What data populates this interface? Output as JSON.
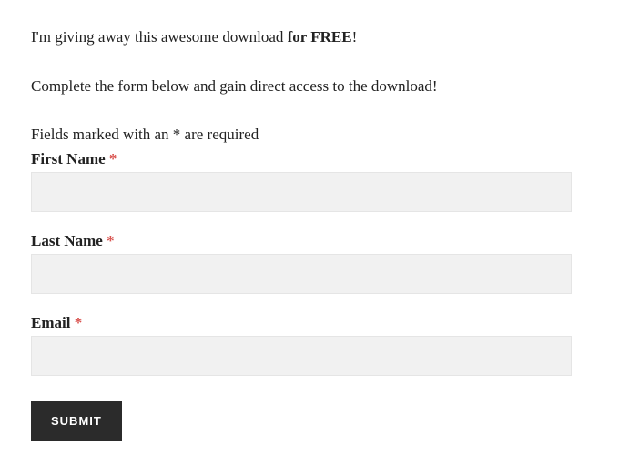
{
  "intro": {
    "prefix": "I'm giving away this awesome download ",
    "bold": "for FREE",
    "suffix": "!"
  },
  "subtext": "Complete the form below and gain direct access to the download!",
  "required_note": "Fields marked with an * are required",
  "fields": {
    "first_name": {
      "label": "First Name ",
      "star": "*",
      "value": ""
    },
    "last_name": {
      "label": "Last Name ",
      "star": "*",
      "value": ""
    },
    "email": {
      "label": "Email ",
      "star": "*",
      "value": ""
    }
  },
  "submit_label": "SUBMIT"
}
